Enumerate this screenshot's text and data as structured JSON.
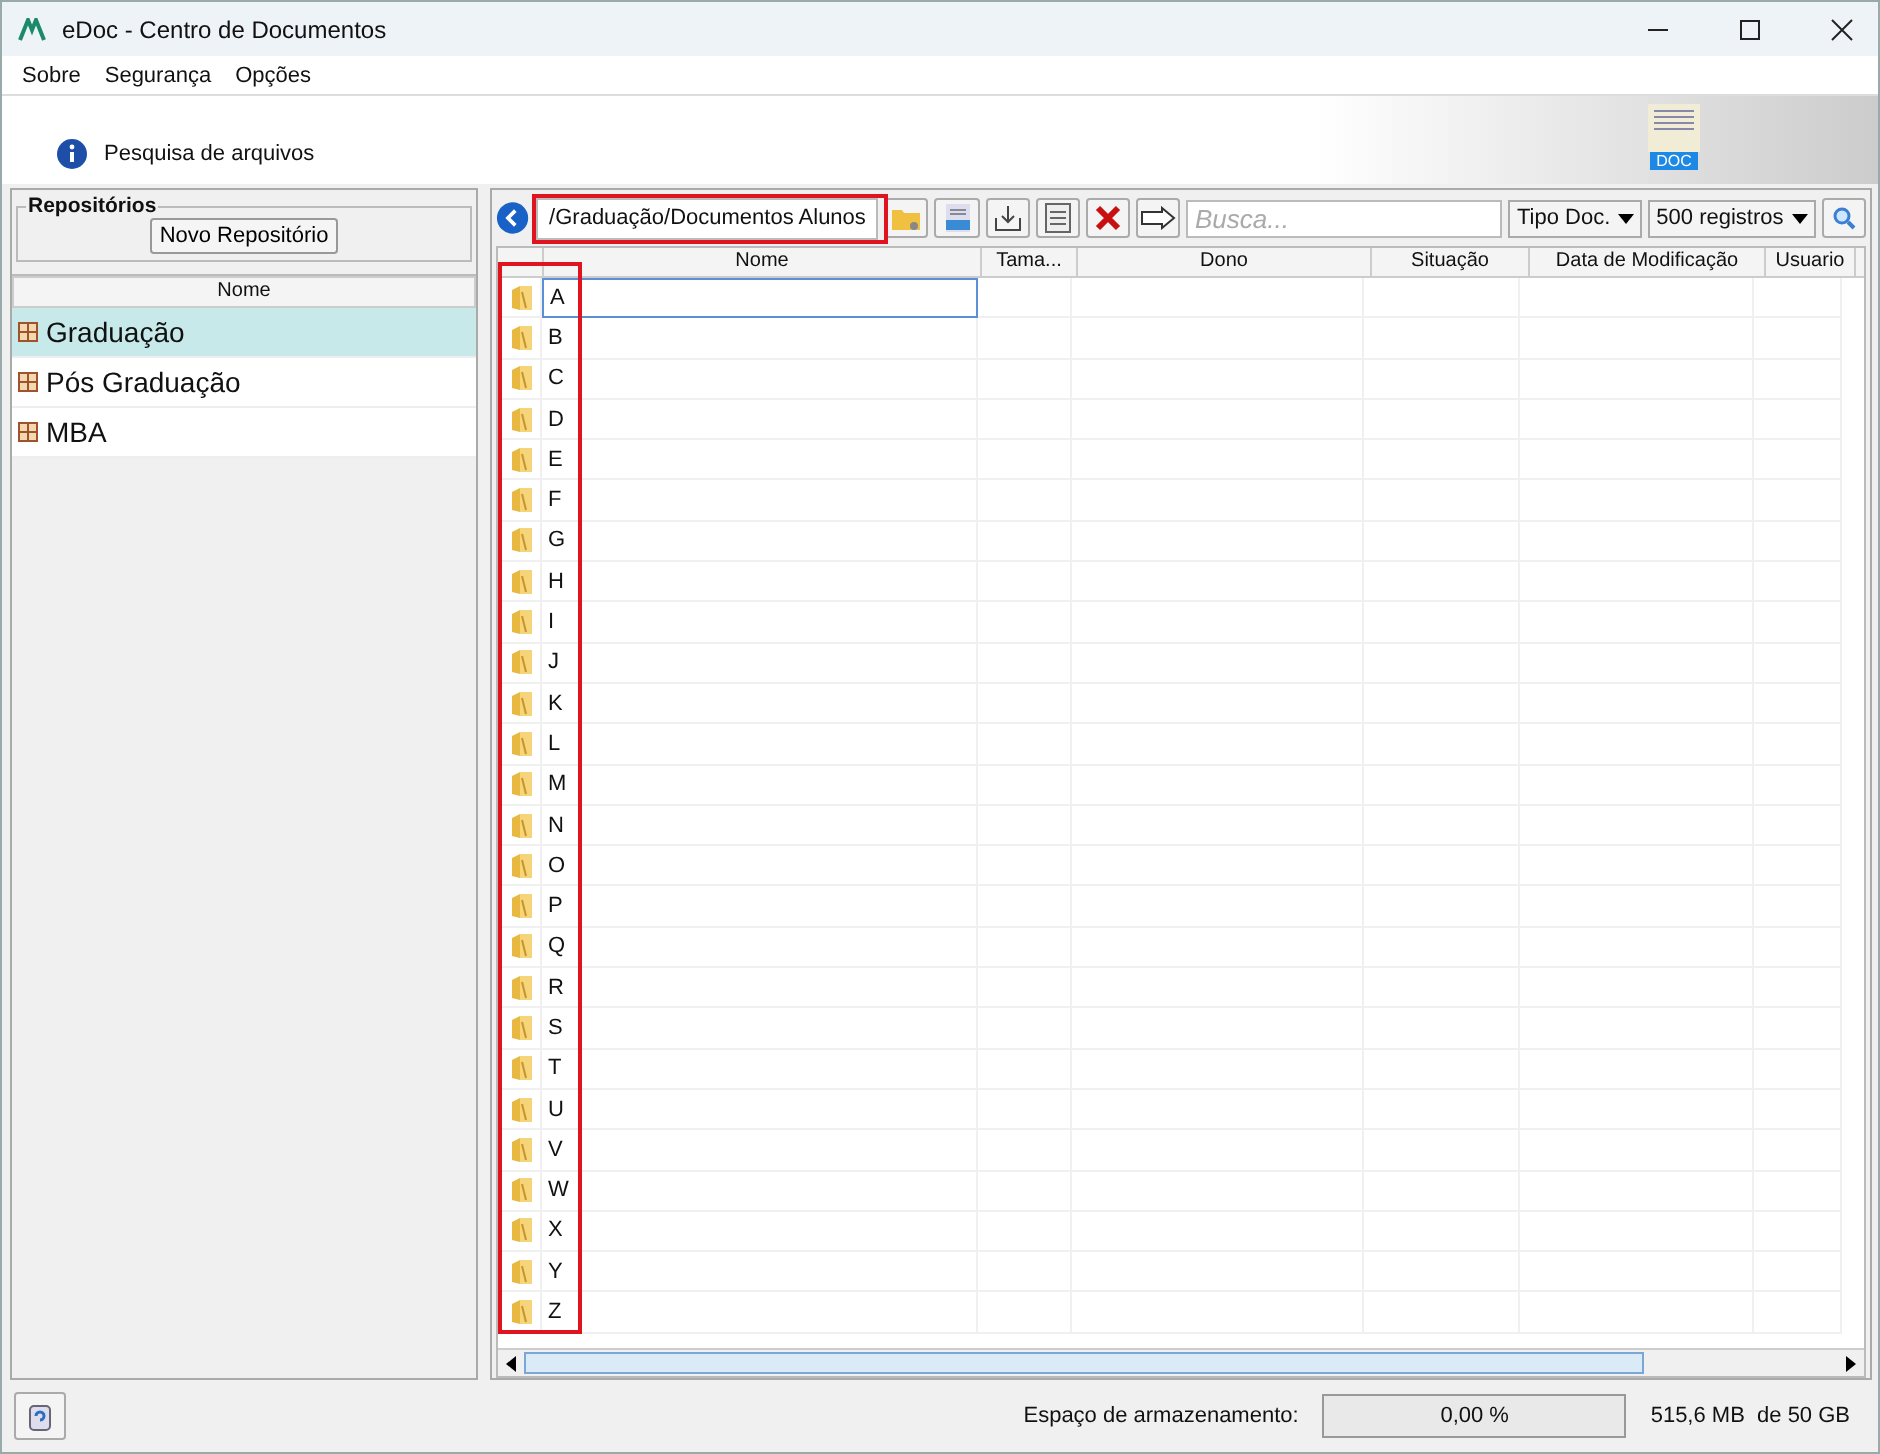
{
  "window": {
    "title": "eDoc - Centro de Documentos"
  },
  "menu": [
    {
      "label": "Sobre"
    },
    {
      "label": "Segurança"
    },
    {
      "label": "Opções"
    }
  ],
  "header": {
    "title": "Pesquisa de arquivos",
    "badge": "DOC"
  },
  "sidebar": {
    "group_title": "Repositórios",
    "new_button": "Novo Repositório",
    "column": "Nome",
    "items": [
      {
        "label": "Graduação",
        "selected": true
      },
      {
        "label": "Pós Graduação",
        "selected": false
      },
      {
        "label": "MBA",
        "selected": false
      }
    ]
  },
  "toolbar": {
    "path": "/Graduação/Documentos Alunos",
    "path_highlighted": true,
    "search_placeholder": "Busca...",
    "type_filter": "Tipo Doc.",
    "records": "500 registros"
  },
  "table": {
    "columns": [
      "Nome",
      "Tama...",
      "Dono",
      "Situação",
      "Data de Modificação",
      "Usuario"
    ],
    "icons_highlighted": true,
    "rows": [
      {
        "name": "A",
        "selected": true
      },
      {
        "name": "B",
        "selected": false
      },
      {
        "name": "C",
        "selected": false
      },
      {
        "name": "D",
        "selected": false
      },
      {
        "name": "E",
        "selected": false
      },
      {
        "name": "F",
        "selected": false
      },
      {
        "name": "G",
        "selected": false
      },
      {
        "name": "H",
        "selected": false
      },
      {
        "name": "I",
        "selected": false
      },
      {
        "name": "J",
        "selected": false
      },
      {
        "name": "K",
        "selected": false
      },
      {
        "name": "L",
        "selected": false
      },
      {
        "name": "M",
        "selected": false
      },
      {
        "name": "N",
        "selected": false
      },
      {
        "name": "O",
        "selected": false
      },
      {
        "name": "P",
        "selected": false
      },
      {
        "name": "Q",
        "selected": false
      },
      {
        "name": "R",
        "selected": false
      },
      {
        "name": "S",
        "selected": false
      },
      {
        "name": "T",
        "selected": false
      },
      {
        "name": "U",
        "selected": false
      },
      {
        "name": "V",
        "selected": false
      },
      {
        "name": "W",
        "selected": false
      },
      {
        "name": "X",
        "selected": false
      },
      {
        "name": "Y",
        "selected": false
      },
      {
        "name": "Z",
        "selected": false
      }
    ]
  },
  "status_bar": {
    "label": "Espaço de armazenamento:",
    "percent": "0,00 %",
    "usage": "515,6 MB  de 50 GB"
  }
}
